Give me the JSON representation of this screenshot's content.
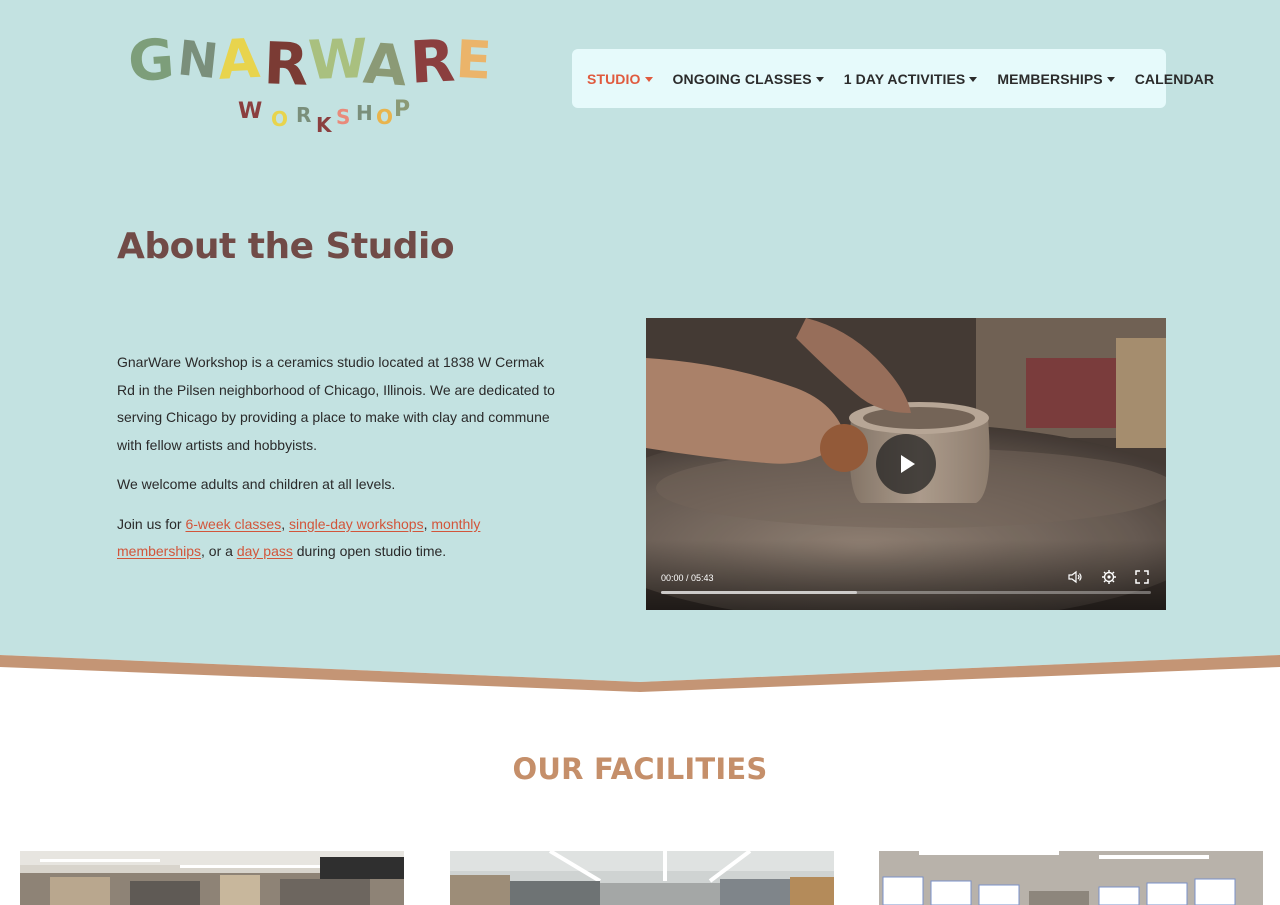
{
  "brand": {
    "logo_line1": "GNARWARE",
    "logo_line2": "WORKSHOP",
    "logo_colors": [
      "#7d9e7a",
      "#7a8f7b",
      "#e8d44d",
      "#7b3b34",
      "#a9c07f",
      "#8b9a76",
      "#8b3f3f",
      "#ebb46a"
    ]
  },
  "nav": {
    "items": [
      {
        "label": "STUDIO",
        "has_dropdown": true,
        "active": true
      },
      {
        "label": "ONGOING CLASSES",
        "has_dropdown": true,
        "active": false
      },
      {
        "label": "1 DAY ACTIVITIES",
        "has_dropdown": true,
        "active": false
      },
      {
        "label": "MEMBERSHIPS",
        "has_dropdown": true,
        "active": false
      },
      {
        "label": "CALENDAR",
        "has_dropdown": false,
        "active": false
      }
    ]
  },
  "about": {
    "title": "About the Studio",
    "paragraph1": "GnarWare Workshop is a ceramics studio located at 1838 W Cermak Rd in the Pilsen neighborhood of Chicago, Illinois. We are dedicated to serving Chicago by providing a place to make with clay and commune with fellow artists and hobbyists.",
    "paragraph2": "We welcome adults and children at all levels.",
    "paragraph3": {
      "prefix": "Join us for ",
      "link1": "6-week classes",
      "sep1": ", ",
      "link2": "single-day workshops",
      "sep2": ", ",
      "link3": "monthly memberships",
      "sep3": ", or a ",
      "link4": "day pass",
      "suffix": " during open studio time."
    }
  },
  "video": {
    "time": "00:00 / 05:43",
    "buffered": 0.4,
    "icons": [
      "play-icon",
      "volume-icon",
      "settings-icon",
      "fullscreen-icon"
    ]
  },
  "facilities": {
    "title": "OUR FACILITIES",
    "photos": [
      "facility-photo-1",
      "facility-photo-2",
      "facility-photo-3"
    ]
  },
  "colors": {
    "hero_bg": "#c3e2e1",
    "nav_bg": "#e6fafb",
    "accent": "#e05a3e",
    "title": "#714b47",
    "wave": "#c49575",
    "facilities_title": "#c58f6a"
  }
}
